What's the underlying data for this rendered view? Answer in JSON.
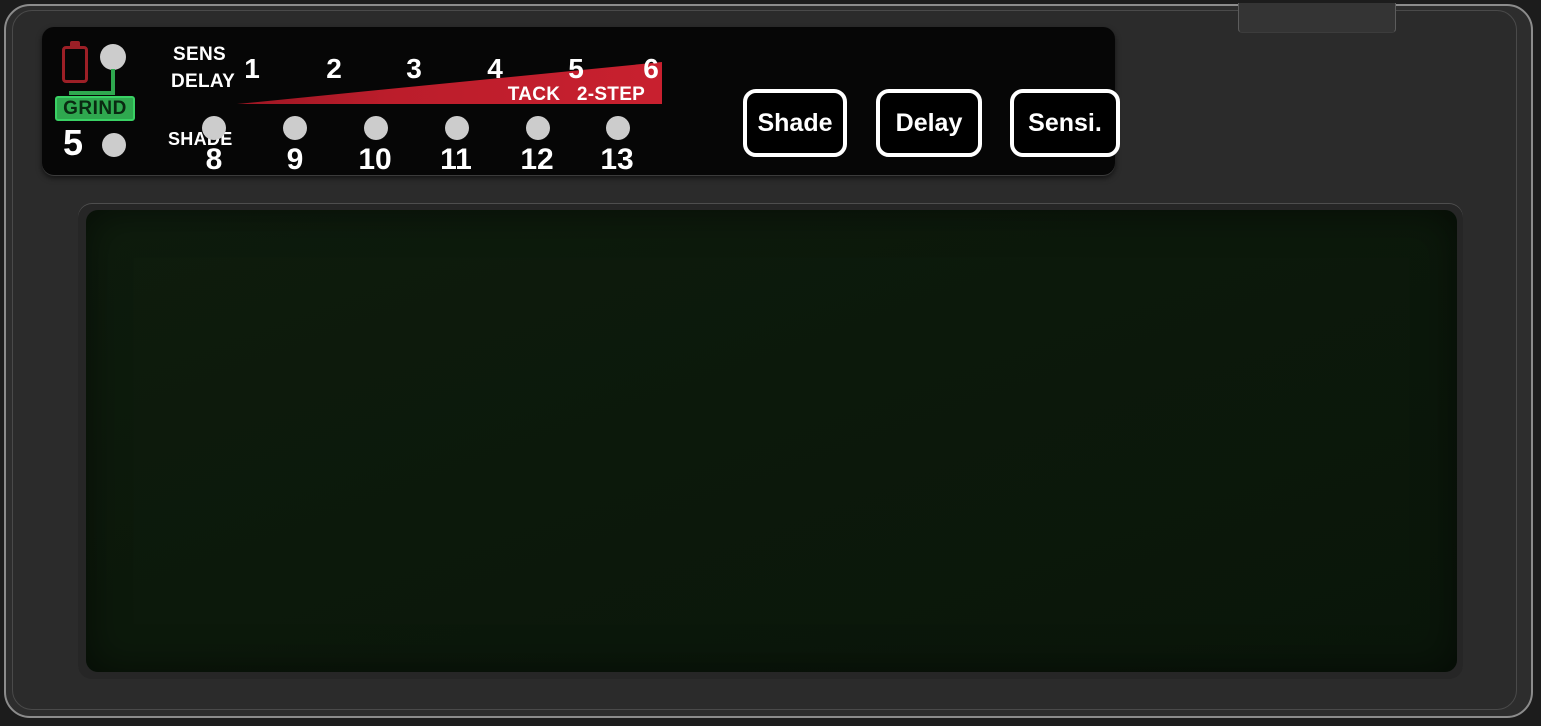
{
  "device": {
    "name": "auto-darkening-welding-helmet-control-panel"
  },
  "panel": {
    "battery_icon": "battery-icon",
    "grind_badge": "GRIND",
    "sens_label": "SENS",
    "delay_label": "DELAY",
    "shade_label": "SHADE",
    "left_value": "5",
    "scale_top": [
      {
        "num": "1",
        "sub": ""
      },
      {
        "num": "2",
        "sub": ""
      },
      {
        "num": "3",
        "sub": ""
      },
      {
        "num": "4",
        "sub": ""
      },
      {
        "num": "5",
        "sub": "TACK"
      },
      {
        "num": "6",
        "sub": "2-STEP"
      }
    ],
    "scale_bottom": [
      "8",
      "9",
      "10",
      "11",
      "12",
      "13"
    ],
    "leds": [
      {
        "name": "led-sens-delay-top",
        "state": "on"
      },
      {
        "name": "led-shade-5",
        "state": "on"
      },
      {
        "name": "led-1-8",
        "state": "on"
      },
      {
        "name": "led-2-9",
        "state": "on"
      },
      {
        "name": "led-3-10",
        "state": "on"
      },
      {
        "name": "led-4-11",
        "state": "on"
      },
      {
        "name": "led-5-12",
        "state": "on"
      },
      {
        "name": "led-6-13",
        "state": "on"
      }
    ],
    "buttons": {
      "shade": "Shade",
      "delay": "Delay",
      "sensi": "Sensi."
    }
  },
  "colors": {
    "panel_black": "#060606",
    "shell_gray": "#2d2d2d",
    "wedge_red": "#c8202f",
    "wedge_red_dark": "#8e1520",
    "grind_green": "#2fa84f",
    "battery_red": "#9c1f26",
    "led_gray": "#cccccc",
    "lens_green": "#0c190b",
    "text_white": "#ffffff"
  }
}
